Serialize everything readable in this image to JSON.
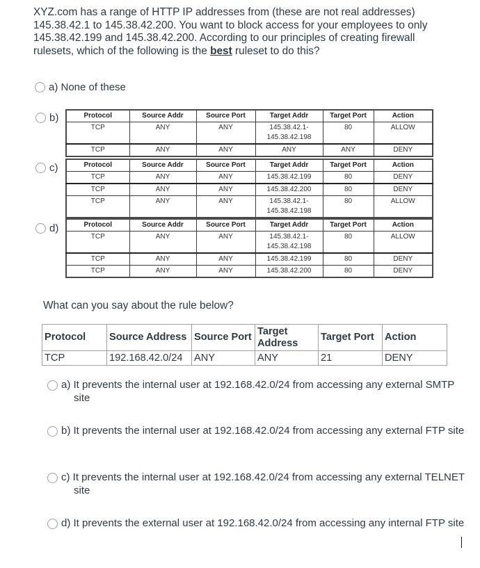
{
  "question1": {
    "text_before_bold": "XYZ.com has a range of HTTP IP addresses from (these are not real addresses) 145.38.42.1 to 145.38.42.200. You want to block access for your employees to only 145.38.42.199 and 145.38.42.200. According to our principles of creating firewall rulesets, which of the following is the ",
    "bold_word": "best",
    "text_after_bold": " ruleset to do this?",
    "options": [
      {
        "label": "a) None of these"
      },
      {
        "label": "b)",
        "headers": [
          "Protocol",
          "Source Addr",
          "Source Port",
          "Target Addr",
          "Target Port",
          "Action"
        ],
        "rows": [
          [
            "TCP",
            "ANY",
            "ANY",
            "145.38.42.1-\n145.38.42.198",
            "80",
            "ALLOW"
          ],
          [
            "TCP",
            "ANY",
            "ANY",
            "ANY",
            "ANY",
            "DENY"
          ]
        ]
      },
      {
        "label": "c)",
        "headers": [
          "Protocol",
          "Source Addr",
          "Source Port",
          "Target Addr",
          "Target Port",
          "Action"
        ],
        "rows": [
          [
            "TCP",
            "ANY",
            "ANY",
            "145.38.42.199",
            "80",
            "DENY"
          ],
          [
            "TCP",
            "ANY",
            "ANY",
            "145.38.42.200",
            "80",
            "DENY"
          ],
          [
            "TCP",
            "ANY",
            "ANY",
            "145.38.42.1-\n145.38.42.198",
            "80",
            "ALLOW"
          ]
        ]
      },
      {
        "label": "d)",
        "headers": [
          "Protocol",
          "Source Addr",
          "Source Port",
          "Target Addr",
          "Target Port",
          "Action"
        ],
        "rows": [
          [
            "TCP",
            "ANY",
            "ANY",
            "145.38.42.1-\n145.38.42.198",
            "80",
            "ALLOW"
          ],
          [
            "TCP",
            "ANY",
            "ANY",
            "145.38.42.199",
            "80",
            "DENY"
          ],
          [
            "TCP",
            "ANY",
            "ANY",
            "145.38.42.200",
            "80",
            "DENY"
          ]
        ]
      }
    ]
  },
  "question2": {
    "text": "What can you say about the rule below?",
    "rule_table": {
      "headers": [
        "Protocol",
        "Source Address",
        "Source Port",
        "Target Address",
        "Target Port",
        "Action"
      ],
      "row": [
        "TCP",
        "192.168.42.0/24",
        "ANY",
        "ANY",
        "21",
        "DENY"
      ]
    },
    "options": [
      {
        "label": "a) It prevents the internal user at 192.168.42.0/24 from accessing any external SMTP site"
      },
      {
        "label": "b) It prevents the internal user at 192.168.42.0/24 from accessing any external FTP site"
      },
      {
        "label": "c) It prevents the internal user at 192.168.42.0/24 from accessing any external TELNET site"
      },
      {
        "label": "d) It prevents the external user at 192.168.42.0/24 from accessing any internal FTP site"
      }
    ]
  }
}
